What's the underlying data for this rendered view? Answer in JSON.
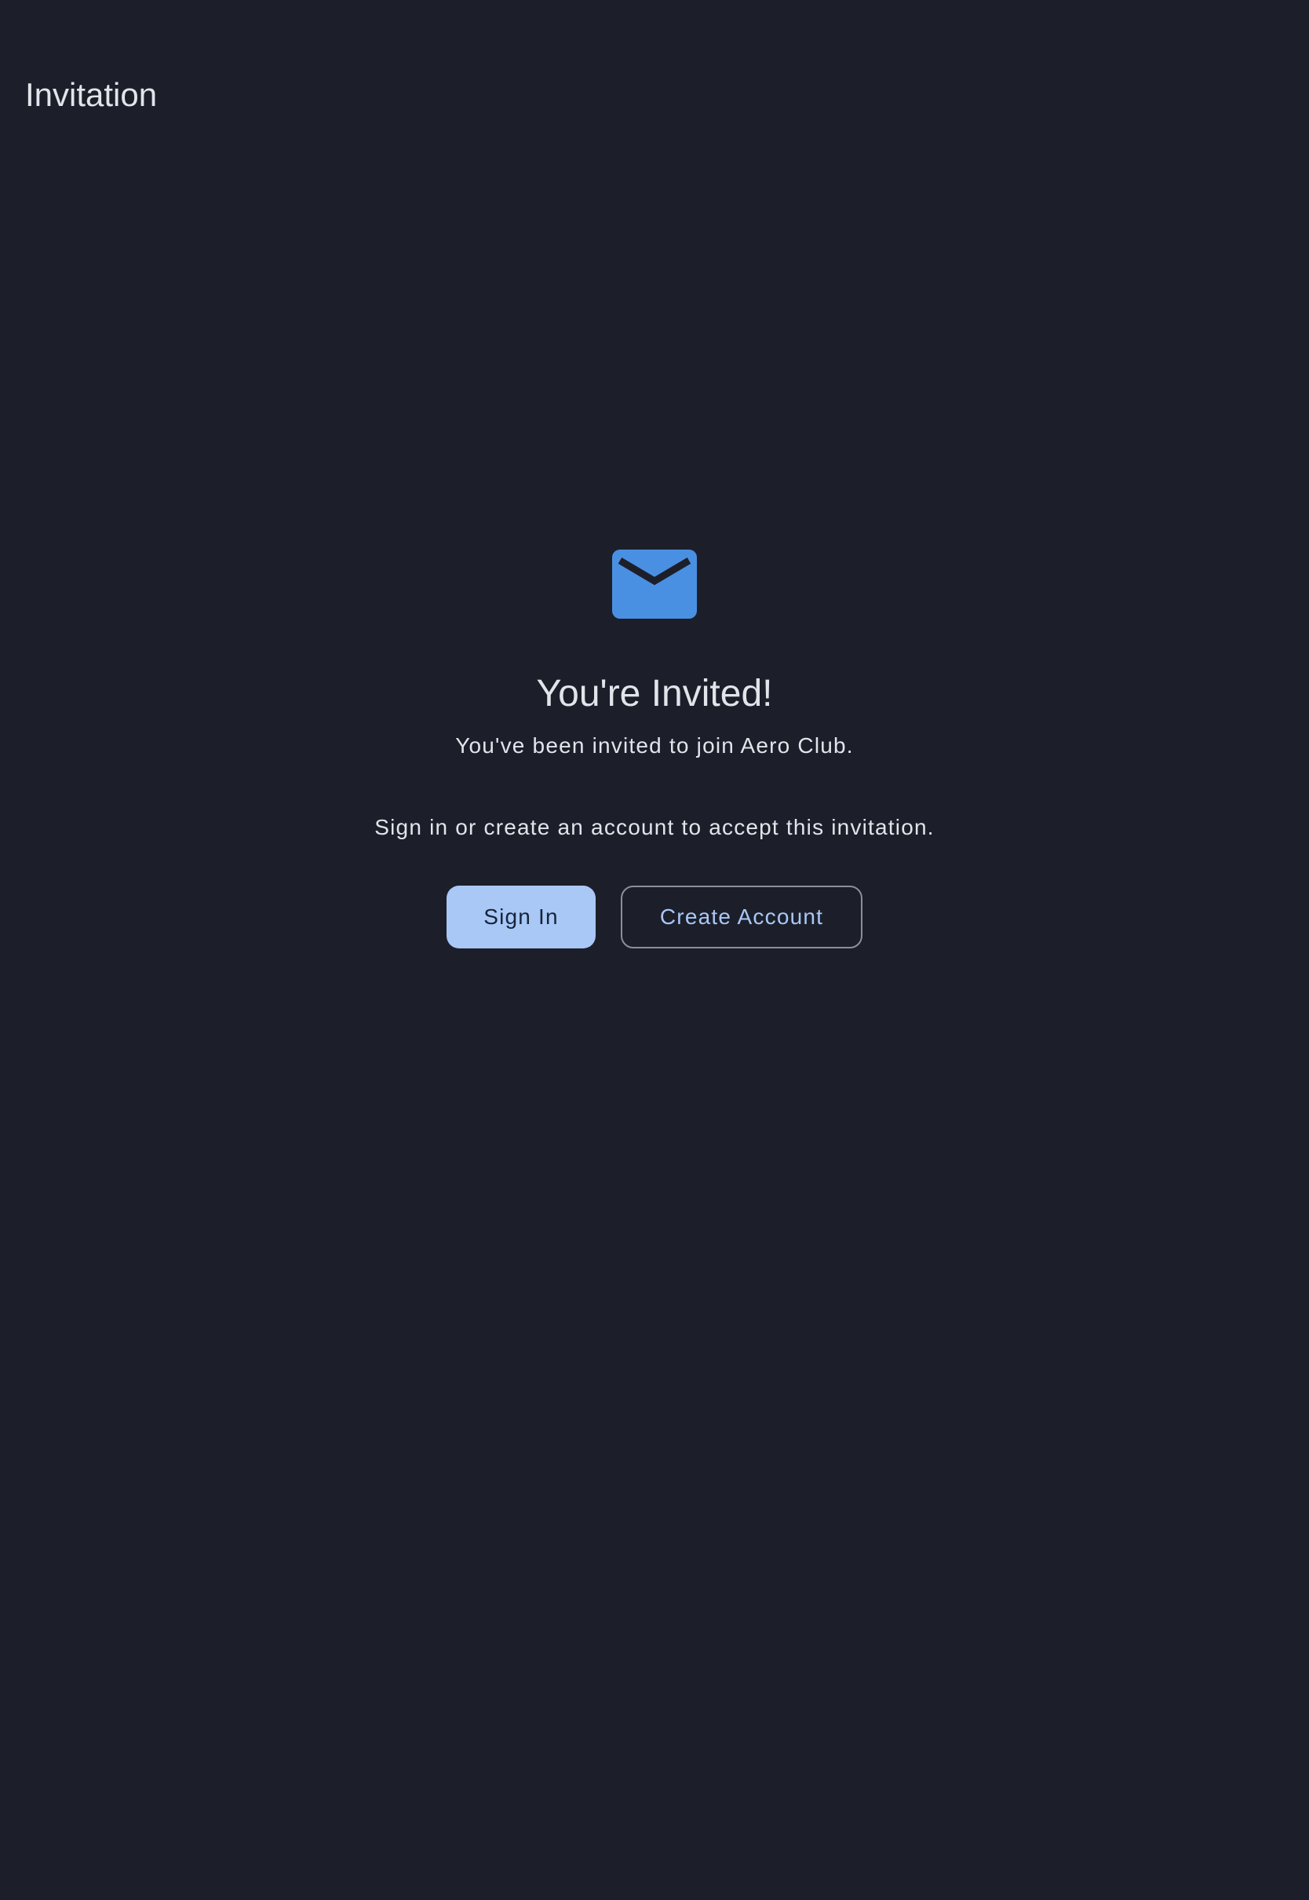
{
  "app_bar": {
    "title": "Invitation"
  },
  "invitation": {
    "icon": "mail-icon",
    "headline": "You're Invited!",
    "subtitle": "You've been invited to join Aero Club.",
    "instruction": "Sign in or create an account to accept this invitation."
  },
  "actions": {
    "sign_in_label": "Sign In",
    "create_account_label": "Create Account"
  },
  "colors": {
    "background": "#1c1f2a",
    "accent": "#4a90e2",
    "primary_button": "#a9c8f6",
    "text": "#e3e4ea"
  }
}
